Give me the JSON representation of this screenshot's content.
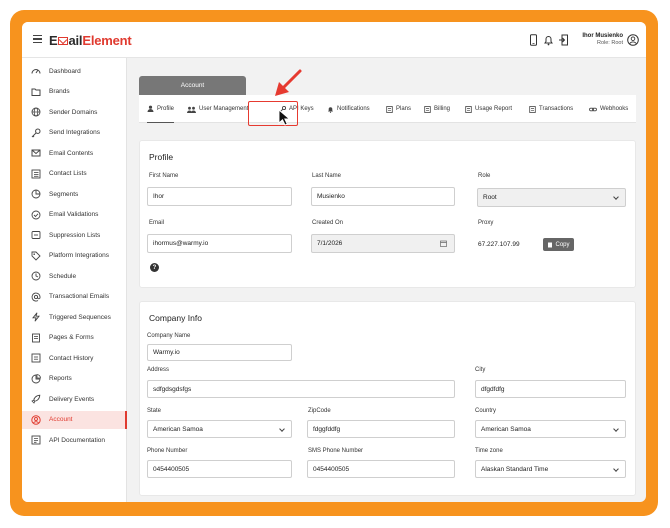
{
  "header": {
    "logo_part1": "E",
    "logo_part2": "ail",
    "logo_part3": "Element",
    "user_name": "Ihor Musienko",
    "user_role": "Role: Root",
    "icons": [
      "phone-icon",
      "bell-icon",
      "logout-icon",
      "user-circle-icon"
    ]
  },
  "sidebar": {
    "items": [
      {
        "label": "Dashboard",
        "icon": "gauge-icon"
      },
      {
        "label": "Brands",
        "icon": "folder-icon"
      },
      {
        "label": "Sender Domains",
        "icon": "globe-icon"
      },
      {
        "label": "Send Integrations",
        "icon": "key-icon"
      },
      {
        "label": "Email Contents",
        "icon": "mail-icon"
      },
      {
        "label": "Contact Lists",
        "icon": "list-icon"
      },
      {
        "label": "Segments",
        "icon": "segment-icon"
      },
      {
        "label": "Email Validations",
        "icon": "check-circle-icon"
      },
      {
        "label": "Suppression Lists",
        "icon": "block-icon"
      },
      {
        "label": "Platform Integrations",
        "icon": "tag-icon"
      },
      {
        "label": "Schedule",
        "icon": "clock-icon"
      },
      {
        "label": "Transactional Emails",
        "icon": "at-icon"
      },
      {
        "label": "Triggered Sequences",
        "icon": "lightning-icon"
      },
      {
        "label": "Pages & Forms",
        "icon": "pages-icon"
      },
      {
        "label": "Contact History",
        "icon": "history-icon"
      },
      {
        "label": "Reports",
        "icon": "pie-icon"
      },
      {
        "label": "Delivery Events",
        "icon": "rocket-icon"
      },
      {
        "label": "Account",
        "icon": "account-icon",
        "active": true
      },
      {
        "label": "API Documentation",
        "icon": "doc-icon"
      }
    ]
  },
  "account_tab": "Account",
  "tabs": [
    {
      "label": "Profile",
      "icon": "user-icon"
    },
    {
      "label": "User Management",
      "icon": "users-icon"
    },
    {
      "label": "API Keys",
      "icon": "key-icon"
    },
    {
      "label": "Notifications",
      "icon": "bell-icon"
    },
    {
      "label": "Plans",
      "icon": "plans-icon"
    },
    {
      "label": "Billing",
      "icon": "billing-icon"
    },
    {
      "label": "Usage Report",
      "icon": "report-icon"
    },
    {
      "label": "Transactions",
      "icon": "transactions-icon"
    },
    {
      "label": "Webhooks",
      "icon": "link-icon"
    }
  ],
  "profile": {
    "title": "Profile",
    "first_name_label": "First Name",
    "first_name": "Ihor",
    "last_name_label": "Last Name",
    "last_name": "Musienko",
    "role_label": "Role",
    "role": "Root",
    "email_label": "Email",
    "email": "ihormus@warmy.io",
    "created_label": "Created On",
    "created": "7/1/2026",
    "proxy_label": "Proxy",
    "proxy": "67.227.107.99",
    "copy_label": "Copy",
    "help": "?"
  },
  "company": {
    "title": "Company Info",
    "name_label": "Company Name",
    "name": "Warmy.io",
    "address_label": "Address",
    "address": "sdfgdsgdsfgs",
    "city_label": "City",
    "city": "dfgdfdfg",
    "state_label": "State",
    "state": "American Samoa",
    "zip_label": "ZipCode",
    "zip": "fdggfddfg",
    "country_label": "Country",
    "country": "American Samoa",
    "phone_label": "Phone Number",
    "phone": "0454400505",
    "sms_label": "SMS Phone Number",
    "sms": "0454400505",
    "tz_label": "Time zone",
    "tz": "Alaskan Standard Time"
  },
  "colors": {
    "brand": "#e03a2f",
    "frame": "#f7931e",
    "active_bg": "#fbe3e1"
  }
}
